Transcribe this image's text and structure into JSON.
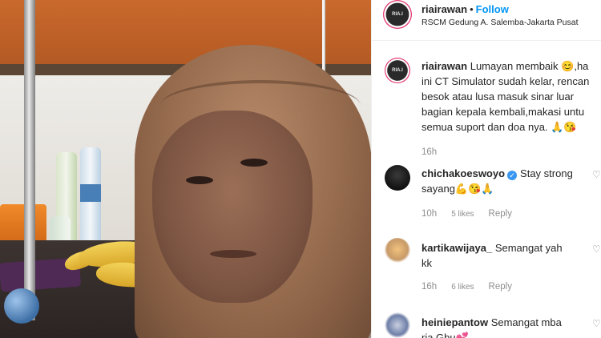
{
  "post": {
    "username": "riairawan",
    "separator": "•",
    "follow_label": "Follow",
    "location": "RSCM Gedung A. Salemba-Jakarta Pusat",
    "avatar_text": "RIA.I"
  },
  "caption": {
    "username": "riairawan",
    "lines": [
      "Lumayan membaik 😊,ha",
      "ini CT Simulator sudah kelar, rencan",
      "besok atau lusa masuk sinar luar",
      "bagian kepala kembali,makasi untu",
      "semua suport dan doa nya. 🙏😘"
    ],
    "time": "16h"
  },
  "comments": [
    {
      "username": "chichakoeswoyo",
      "verified": true,
      "text_line1": "Stay strong",
      "text_line2": "sayang💪😘🙏",
      "time": "10h",
      "likes": "5 likes",
      "reply": "Reply"
    },
    {
      "username": "kartikawijaya_",
      "text_line1": "Semangat yah",
      "text_line2": "kk",
      "time": "16h",
      "likes": "6 likes",
      "reply": "Reply"
    },
    {
      "username": "heiniepantow",
      "text_line1": "Semangat mba",
      "text_line2": "ria Gbu💕"
    }
  ],
  "icons": {
    "heart": "♡",
    "verified": "✓"
  },
  "colors": {
    "follow": "#0095f6",
    "verified": "#3897f0",
    "meta": "#8e8e8e",
    "text": "#262626"
  }
}
